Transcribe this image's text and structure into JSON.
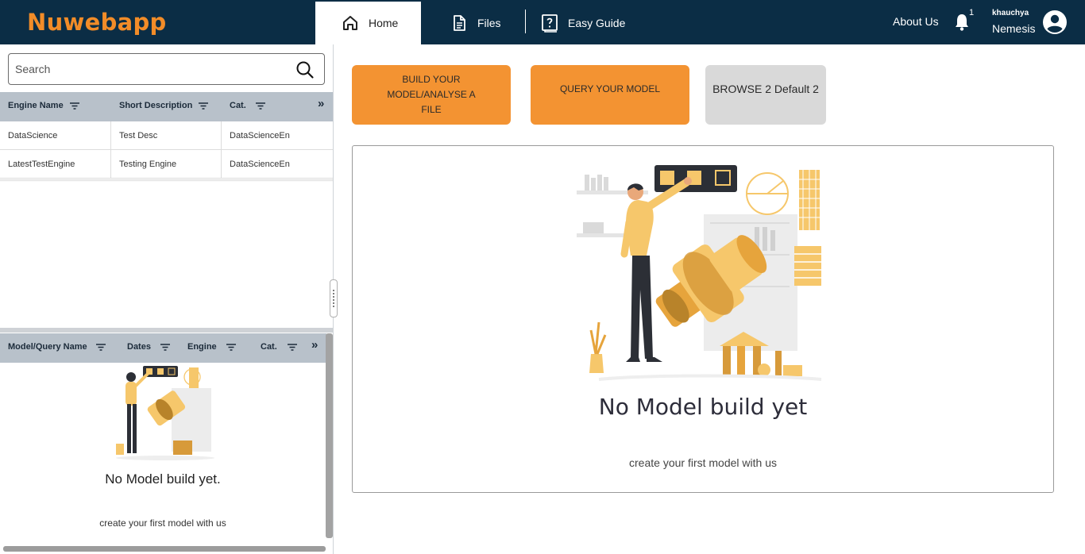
{
  "app": {
    "logo": "Nuwebapp"
  },
  "nav": {
    "tabs": [
      {
        "label": "Home",
        "icon": "home-icon",
        "active": true
      },
      {
        "label": "Files",
        "icon": "file-icon",
        "active": false
      },
      {
        "label": "Easy Guide",
        "icon": "help-book-icon",
        "active": false
      }
    ],
    "about": "About Us",
    "notification_count": "1",
    "user": {
      "name": "khauchya",
      "org": "Nemesis"
    }
  },
  "left": {
    "search": {
      "placeholder": "Search",
      "value": ""
    },
    "engines_grid": {
      "columns": [
        "Engine Name",
        "Short Description",
        "Cat."
      ],
      "rows": [
        [
          "DataScience",
          "Test Desc",
          "DataScienceEn"
        ],
        [
          "LatestTestEngine",
          "Testing Engine",
          "DataScienceEn"
        ]
      ]
    },
    "models_grid": {
      "columns": [
        "Model/Query Name",
        "Dates",
        "Engine",
        "Cat."
      ],
      "rows": []
    },
    "empty": {
      "title": "No Model build yet.",
      "subtitle": "create your first model with us"
    }
  },
  "actions": {
    "build": "BUILD YOUR MODEL/ANALYSE A FILE",
    "query": "QUERY YOUR MODEL",
    "browse": "BROWSE 2 Default 2"
  },
  "main": {
    "empty": {
      "title": "No Model build yet",
      "subtitle": "create your first model with us"
    }
  },
  "colors": {
    "nav_bg": "#0b2d45",
    "brand_orange": "#f28c28",
    "button_orange": "#f39332",
    "button_grey": "#d9d9d9",
    "grid_header": "#b8c1ca"
  }
}
